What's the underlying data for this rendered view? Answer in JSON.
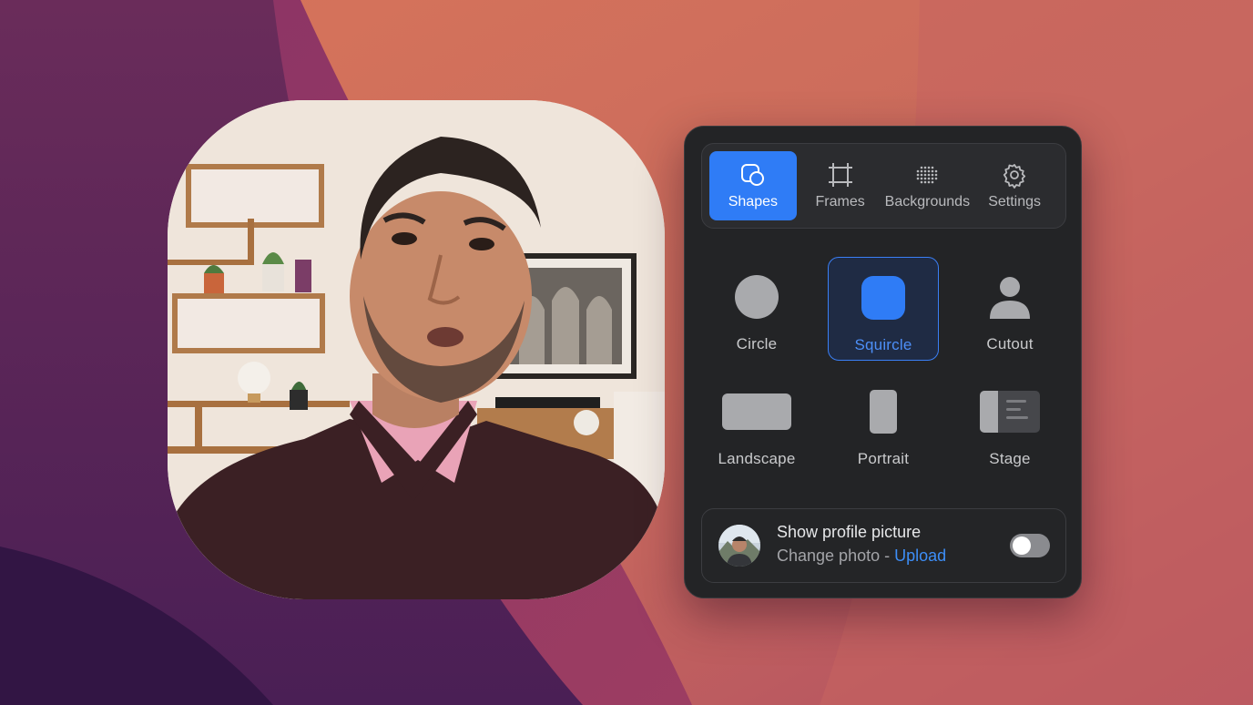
{
  "tabs": [
    {
      "label": "Shapes",
      "icon": "shapes-icon",
      "active": true
    },
    {
      "label": "Frames",
      "icon": "frame-crop-icon",
      "active": false
    },
    {
      "label": "Backgrounds",
      "icon": "dot-grid-icon",
      "active": false
    },
    {
      "label": "Settings",
      "icon": "gear-icon",
      "active": false
    }
  ],
  "shapes": [
    {
      "label": "Circle",
      "icon": "circle-shape-icon",
      "selected": false
    },
    {
      "label": "Squircle",
      "icon": "squircle-shape-icon",
      "selected": true
    },
    {
      "label": "Cutout",
      "icon": "person-cutout-icon",
      "selected": false
    },
    {
      "label": "Landscape",
      "icon": "landscape-shape-icon",
      "selected": false
    },
    {
      "label": "Portrait",
      "icon": "portrait-shape-icon",
      "selected": false
    },
    {
      "label": "Stage",
      "icon": "stage-layout-icon",
      "selected": false
    }
  ],
  "profile": {
    "title": "Show profile picture",
    "change_text": "Change photo -",
    "upload_link": "Upload",
    "toggle_on": false
  },
  "colors": {
    "accent": "#2f7cf6",
    "link": "#3d8ef7",
    "panel_bg": "#232426",
    "shape_gray": "#a9aaad",
    "selected_fill": "#2f7cf6"
  }
}
